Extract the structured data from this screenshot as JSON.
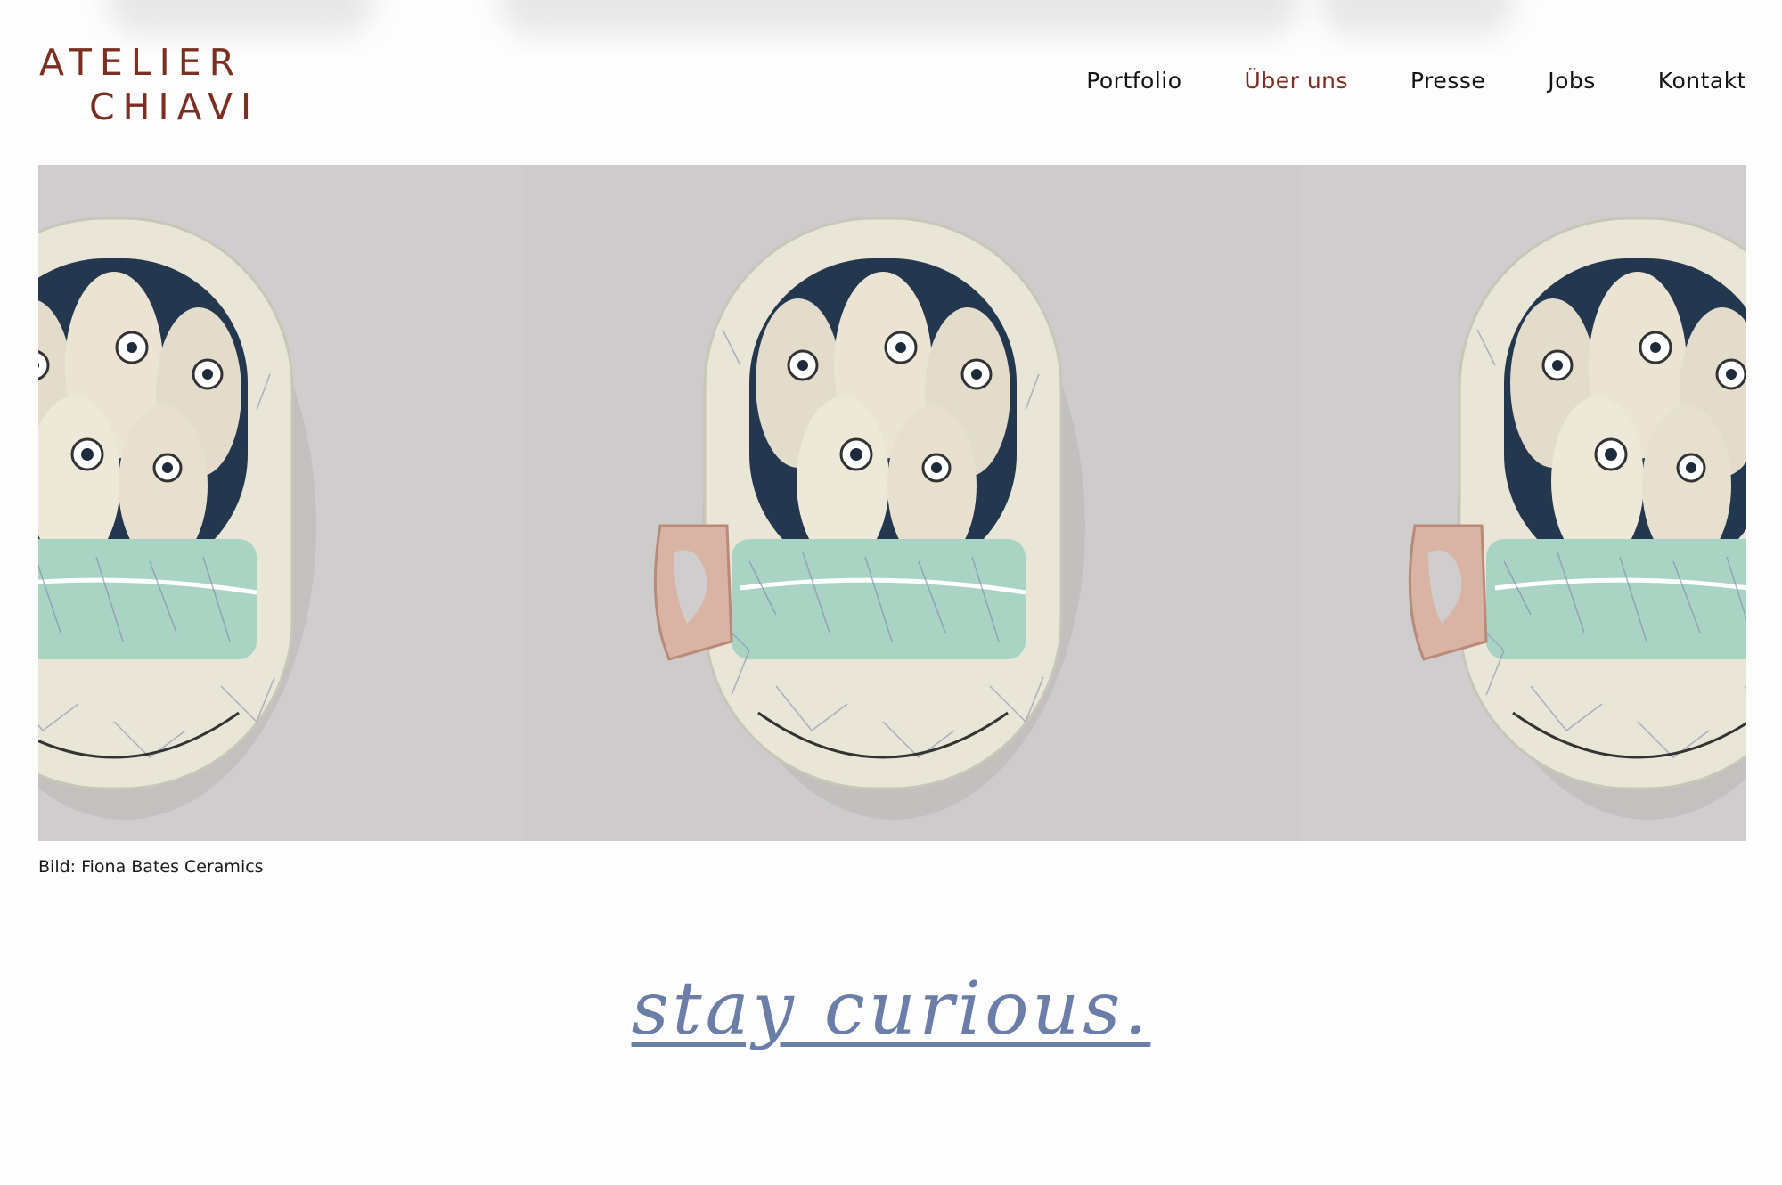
{
  "header": {
    "logo_line1": "ATELIER",
    "logo_line2": "CHIAVI",
    "nav": [
      {
        "label": "Portfolio",
        "active": false
      },
      {
        "label": "Über uns",
        "active": true
      },
      {
        "label": "Presse",
        "active": false
      },
      {
        "label": "Jobs",
        "active": false
      },
      {
        "label": "Kontakt",
        "active": false
      }
    ]
  },
  "hero": {
    "caption": "Bild: Fiona Bates Ceramics"
  },
  "tagline": "stay curious.",
  "colors": {
    "brand": "#7b2e22",
    "tagline": "#6a7ea8",
    "hero_background": "#cfcdcd"
  }
}
